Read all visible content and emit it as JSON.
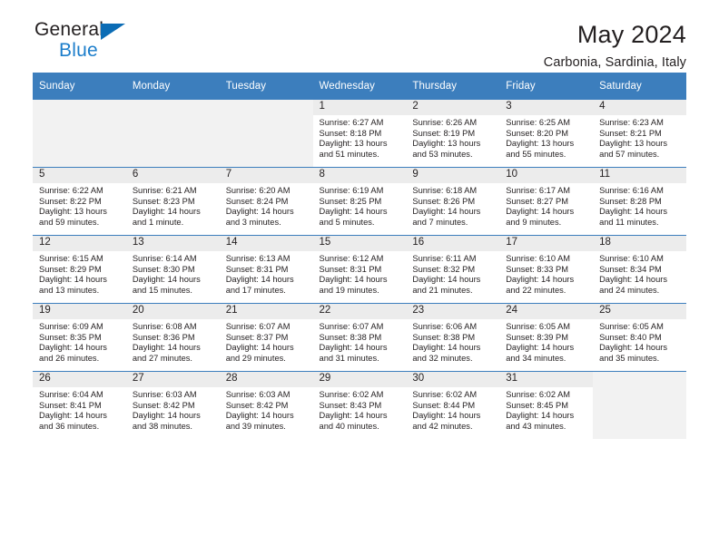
{
  "brand": {
    "name_part1": "General",
    "name_part2": "Blue",
    "accent_color": "#0b6cb5",
    "blue_text_color": "#1c7ecb"
  },
  "header": {
    "title": "May 2024",
    "subtitle": "Carbonia, Sardinia, Italy"
  },
  "theme": {
    "header_row_bg": "#3c7ebd",
    "daynum_bg": "#ececec",
    "empty_cell_bg": "#f2f2f2"
  },
  "weekdays": [
    "Sunday",
    "Monday",
    "Tuesday",
    "Wednesday",
    "Thursday",
    "Friday",
    "Saturday"
  ],
  "weeks": [
    [
      {
        "empty": true
      },
      {
        "empty": true
      },
      {
        "empty": true
      },
      {
        "day": "1",
        "sunrise": "Sunrise: 6:27 AM",
        "sunset": "Sunset: 8:18 PM",
        "daylight": "Daylight: 13 hours and 51 minutes."
      },
      {
        "day": "2",
        "sunrise": "Sunrise: 6:26 AM",
        "sunset": "Sunset: 8:19 PM",
        "daylight": "Daylight: 13 hours and 53 minutes."
      },
      {
        "day": "3",
        "sunrise": "Sunrise: 6:25 AM",
        "sunset": "Sunset: 8:20 PM",
        "daylight": "Daylight: 13 hours and 55 minutes."
      },
      {
        "day": "4",
        "sunrise": "Sunrise: 6:23 AM",
        "sunset": "Sunset: 8:21 PM",
        "daylight": "Daylight: 13 hours and 57 minutes."
      }
    ],
    [
      {
        "day": "5",
        "sunrise": "Sunrise: 6:22 AM",
        "sunset": "Sunset: 8:22 PM",
        "daylight": "Daylight: 13 hours and 59 minutes."
      },
      {
        "day": "6",
        "sunrise": "Sunrise: 6:21 AM",
        "sunset": "Sunset: 8:23 PM",
        "daylight": "Daylight: 14 hours and 1 minute."
      },
      {
        "day": "7",
        "sunrise": "Sunrise: 6:20 AM",
        "sunset": "Sunset: 8:24 PM",
        "daylight": "Daylight: 14 hours and 3 minutes."
      },
      {
        "day": "8",
        "sunrise": "Sunrise: 6:19 AM",
        "sunset": "Sunset: 8:25 PM",
        "daylight": "Daylight: 14 hours and 5 minutes."
      },
      {
        "day": "9",
        "sunrise": "Sunrise: 6:18 AM",
        "sunset": "Sunset: 8:26 PM",
        "daylight": "Daylight: 14 hours and 7 minutes."
      },
      {
        "day": "10",
        "sunrise": "Sunrise: 6:17 AM",
        "sunset": "Sunset: 8:27 PM",
        "daylight": "Daylight: 14 hours and 9 minutes."
      },
      {
        "day": "11",
        "sunrise": "Sunrise: 6:16 AM",
        "sunset": "Sunset: 8:28 PM",
        "daylight": "Daylight: 14 hours and 11 minutes."
      }
    ],
    [
      {
        "day": "12",
        "sunrise": "Sunrise: 6:15 AM",
        "sunset": "Sunset: 8:29 PM",
        "daylight": "Daylight: 14 hours and 13 minutes."
      },
      {
        "day": "13",
        "sunrise": "Sunrise: 6:14 AM",
        "sunset": "Sunset: 8:30 PM",
        "daylight": "Daylight: 14 hours and 15 minutes."
      },
      {
        "day": "14",
        "sunrise": "Sunrise: 6:13 AM",
        "sunset": "Sunset: 8:31 PM",
        "daylight": "Daylight: 14 hours and 17 minutes."
      },
      {
        "day": "15",
        "sunrise": "Sunrise: 6:12 AM",
        "sunset": "Sunset: 8:31 PM",
        "daylight": "Daylight: 14 hours and 19 minutes."
      },
      {
        "day": "16",
        "sunrise": "Sunrise: 6:11 AM",
        "sunset": "Sunset: 8:32 PM",
        "daylight": "Daylight: 14 hours and 21 minutes."
      },
      {
        "day": "17",
        "sunrise": "Sunrise: 6:10 AM",
        "sunset": "Sunset: 8:33 PM",
        "daylight": "Daylight: 14 hours and 22 minutes."
      },
      {
        "day": "18",
        "sunrise": "Sunrise: 6:10 AM",
        "sunset": "Sunset: 8:34 PM",
        "daylight": "Daylight: 14 hours and 24 minutes."
      }
    ],
    [
      {
        "day": "19",
        "sunrise": "Sunrise: 6:09 AM",
        "sunset": "Sunset: 8:35 PM",
        "daylight": "Daylight: 14 hours and 26 minutes."
      },
      {
        "day": "20",
        "sunrise": "Sunrise: 6:08 AM",
        "sunset": "Sunset: 8:36 PM",
        "daylight": "Daylight: 14 hours and 27 minutes."
      },
      {
        "day": "21",
        "sunrise": "Sunrise: 6:07 AM",
        "sunset": "Sunset: 8:37 PM",
        "daylight": "Daylight: 14 hours and 29 minutes."
      },
      {
        "day": "22",
        "sunrise": "Sunrise: 6:07 AM",
        "sunset": "Sunset: 8:38 PM",
        "daylight": "Daylight: 14 hours and 31 minutes."
      },
      {
        "day": "23",
        "sunrise": "Sunrise: 6:06 AM",
        "sunset": "Sunset: 8:38 PM",
        "daylight": "Daylight: 14 hours and 32 minutes."
      },
      {
        "day": "24",
        "sunrise": "Sunrise: 6:05 AM",
        "sunset": "Sunset: 8:39 PM",
        "daylight": "Daylight: 14 hours and 34 minutes."
      },
      {
        "day": "25",
        "sunrise": "Sunrise: 6:05 AM",
        "sunset": "Sunset: 8:40 PM",
        "daylight": "Daylight: 14 hours and 35 minutes."
      }
    ],
    [
      {
        "day": "26",
        "sunrise": "Sunrise: 6:04 AM",
        "sunset": "Sunset: 8:41 PM",
        "daylight": "Daylight: 14 hours and 36 minutes."
      },
      {
        "day": "27",
        "sunrise": "Sunrise: 6:03 AM",
        "sunset": "Sunset: 8:42 PM",
        "daylight": "Daylight: 14 hours and 38 minutes."
      },
      {
        "day": "28",
        "sunrise": "Sunrise: 6:03 AM",
        "sunset": "Sunset: 8:42 PM",
        "daylight": "Daylight: 14 hours and 39 minutes."
      },
      {
        "day": "29",
        "sunrise": "Sunrise: 6:02 AM",
        "sunset": "Sunset: 8:43 PM",
        "daylight": "Daylight: 14 hours and 40 minutes."
      },
      {
        "day": "30",
        "sunrise": "Sunrise: 6:02 AM",
        "sunset": "Sunset: 8:44 PM",
        "daylight": "Daylight: 14 hours and 42 minutes."
      },
      {
        "day": "31",
        "sunrise": "Sunrise: 6:02 AM",
        "sunset": "Sunset: 8:45 PM",
        "daylight": "Daylight: 14 hours and 43 minutes."
      },
      {
        "empty": true
      }
    ]
  ]
}
